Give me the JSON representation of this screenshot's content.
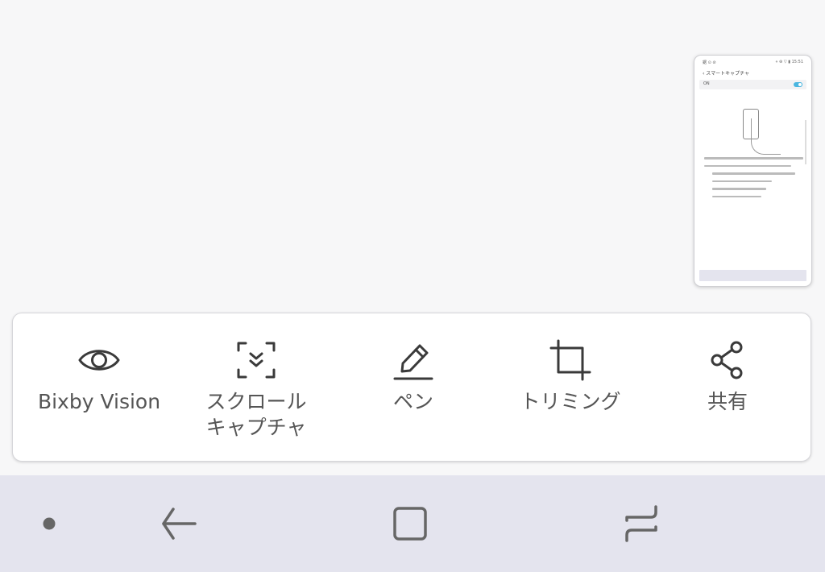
{
  "thumbnail": {
    "status_left": "鋸 ⊙ ⊘",
    "status_right": "⋄ ⊛ ▽ ▮ 15:51",
    "header": "‹  スマートキャプチャ",
    "toggle_label": "ON"
  },
  "toolbar": {
    "items": [
      {
        "label": "Bixby Vision",
        "icon": "eye-icon"
      },
      {
        "label": "スクロール\nキャプチャ",
        "icon": "scroll-capture-icon"
      },
      {
        "label": "ペン",
        "icon": "pen-icon"
      },
      {
        "label": "トリミング",
        "icon": "crop-icon"
      },
      {
        "label": "共有",
        "icon": "share-icon"
      }
    ]
  },
  "navbar": {
    "buttons": [
      "dot-icon",
      "back-icon",
      "home-icon",
      "recents-icon"
    ]
  },
  "colors": {
    "background": "#f7f7f8",
    "toolbar": "#ffffff",
    "navbar": "#e4e4ee",
    "icon": "#3a3a3a",
    "label": "#555555"
  }
}
